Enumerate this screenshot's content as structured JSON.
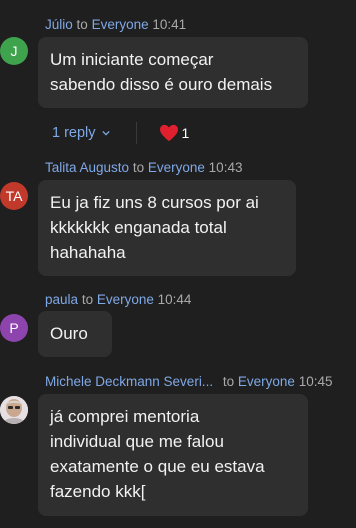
{
  "messages": [
    {
      "initials": "J",
      "avatar_color": "#3fa34d",
      "author": "Júlio",
      "to_word": "to",
      "target": "Everyone",
      "time": "10:41",
      "lines": [
        "Um iniciante começar",
        "sabendo disso é ouro demais"
      ]
    },
    {
      "initials": "TA",
      "avatar_color": "#c0392b",
      "author": "Talita Augusto",
      "to_word": "to",
      "target": "Everyone",
      "time": "10:43",
      "lines": [
        "Eu ja fiz uns 8 cursos por ai",
        "kkkkkkk enganada total",
        "hahahaha"
      ]
    },
    {
      "initials": "P",
      "avatar_color": "#8e44ad",
      "author": "paula",
      "to_word": "to",
      "target": "Everyone",
      "time": "10:44",
      "lines": [
        "Ouro"
      ]
    },
    {
      "initials": "",
      "avatar_color": "#d9d2d4",
      "author": "Michele Deckmann Severi...",
      "to_word": "to",
      "target": "Everyone",
      "time": "10:45",
      "lines": [
        "já comprei mentoria",
        "individual que me falou",
        "exatamente o que eu estava",
        "fazendo kkk["
      ]
    }
  ],
  "reply_label": "1 reply",
  "heart_count": "1",
  "heart_icon": "heart-icon",
  "chevron_icon": "chevron-down-icon"
}
